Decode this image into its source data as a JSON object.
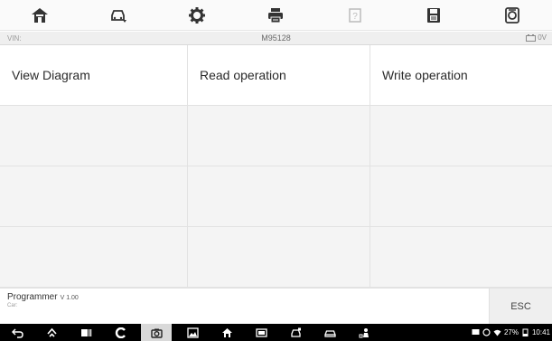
{
  "toolbar": {
    "items": [
      {
        "icon": "home-icon"
      },
      {
        "icon": "vehicle-swap-icon"
      },
      {
        "icon": "gear-icon"
      },
      {
        "icon": "printer-icon"
      },
      {
        "icon": "help-icon"
      },
      {
        "icon": "save-icon"
      },
      {
        "icon": "data-logging-icon"
      }
    ]
  },
  "vin_bar": {
    "vin_label": "VIN:",
    "model": "M95128",
    "voltage": "0V"
  },
  "grid": {
    "headers": [
      "View Diagram",
      "Read operation",
      "Write operation"
    ]
  },
  "footer": {
    "app_name": "Programmer",
    "version": "V 1.00",
    "car_label": "Car:",
    "esc_label": "ESC"
  },
  "navbar": {
    "icons": [
      "back-icon",
      "home-icon",
      "recent-apps-icon",
      "browser-icon",
      "camera-icon",
      "screenshot-icon",
      "autel-home-icon",
      "vci-icon",
      "vehicle-service-icon",
      "car-icon",
      "mechanic-icon"
    ],
    "status": {
      "battery": "27%",
      "time": "10:41"
    }
  },
  "colors": {
    "toolbar_bg": "#fafafa",
    "grid_bg": "#f4f4f4",
    "navbar_bg": "#000000",
    "icon": "#333333"
  }
}
